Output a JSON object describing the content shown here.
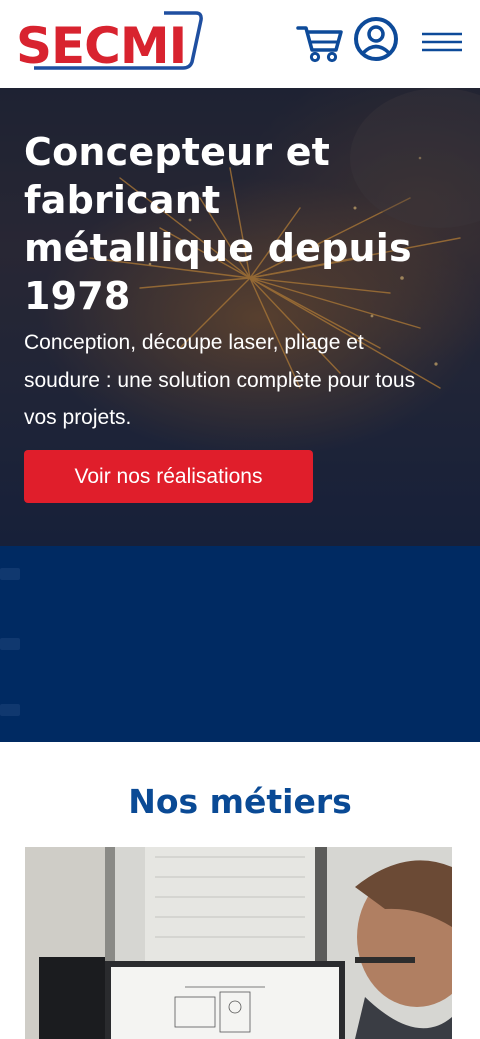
{
  "header": {
    "logo_text": "SECMI",
    "icons": {
      "cart": "shopping-cart-icon",
      "account": "user-account-icon",
      "menu": "hamburger-menu-icon"
    }
  },
  "hero": {
    "title": "Concepteur et fabricant métallique depuis 1978",
    "subtitle": "Conception, découpe laser, pliage et soudure : une solution complète pour tous vos projets.",
    "cta_label": "Voir nos réalisations"
  },
  "metiers": {
    "title": "Nos métiers"
  },
  "colors": {
    "brand_red": "#e01e2b",
    "brand_blue": "#0a4a95",
    "band_navy": "#002a62"
  }
}
